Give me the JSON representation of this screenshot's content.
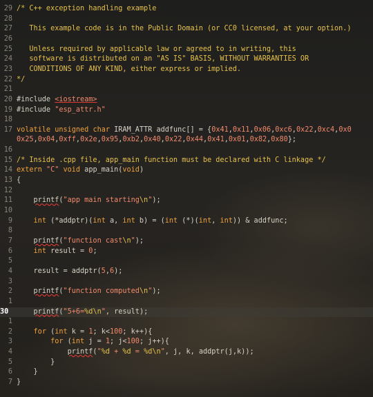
{
  "editor": {
    "lines": [
      {
        "ln": "29",
        "code": "/* C++ exception handling example"
      },
      {
        "ln": "28",
        "code": ""
      },
      {
        "ln": "27",
        "code": "   This example code is in the Public Domain (or CC0 licensed, at your option.)"
      },
      {
        "ln": "26",
        "code": ""
      },
      {
        "ln": "25",
        "code": "   Unless required by applicable law or agreed to in writing, this"
      },
      {
        "ln": "24",
        "code": "   software is distributed on an \"AS IS\" BASIS, WITHOUT WARRANTIES OR"
      },
      {
        "ln": "23",
        "code": "   CONDITIONS OF ANY KIND, either express or implied."
      },
      {
        "ln": "22",
        "code": "*/"
      },
      {
        "ln": "21",
        "code": ""
      },
      {
        "ln": "20",
        "code": "#include <iostream>"
      },
      {
        "ln": "19",
        "code": "#include \"esp_attr.h\""
      },
      {
        "ln": "18",
        "code": ""
      },
      {
        "ln": "17",
        "code": "volatile unsigned char IRAM_ATTR addfunc[] = {0x41,0x11,0x06,0xc6,0x22,0xc4,0x0"
      },
      {
        "ln": "",
        "code": "0x25,0x04,0xff,0x2e,0x95,0xb2,0x40,0x22,0x44,0x41,0x01,0x82,0x80};"
      },
      {
        "ln": "16",
        "code": ""
      },
      {
        "ln": "15",
        "code": "/* Inside .cpp file, app_main function must be declared with C linkage */"
      },
      {
        "ln": "14",
        "code": "extern \"C\" void app_main(void)"
      },
      {
        "ln": "13",
        "code": "{"
      },
      {
        "ln": "12",
        "code": ""
      },
      {
        "ln": "11",
        "code": "    printf(\"app main starting\\n\");"
      },
      {
        "ln": "10",
        "code": ""
      },
      {
        "ln": "9",
        "code": "    int (*addptr)(int a, int b) = (int (*)(int, int)) & addfunc;"
      },
      {
        "ln": "8",
        "code": ""
      },
      {
        "ln": "7",
        "code": "    printf(\"function cast\\n\");"
      },
      {
        "ln": "6",
        "code": "    int result = 0;"
      },
      {
        "ln": "5",
        "code": ""
      },
      {
        "ln": "4",
        "code": "    result = addptr(5,6);"
      },
      {
        "ln": "3",
        "code": ""
      },
      {
        "ln": "2",
        "code": "    printf(\"function computed\\n\");"
      },
      {
        "ln": "1",
        "code": ""
      },
      {
        "ln": "30",
        "code": "    printf(\"5+6=%d\\n\", result);",
        "current": true
      },
      {
        "ln": "1",
        "code": ""
      },
      {
        "ln": "2",
        "code": "    for (int k = 1; k<100; k++){"
      },
      {
        "ln": "3",
        "code": "        for (int j = 1; j<100; j++){"
      },
      {
        "ln": "4",
        "code": "            printf(\"%d + %d = %d\\n\", j, k, addptr(j,k));"
      },
      {
        "ln": "5",
        "code": "        }"
      },
      {
        "ln": "6",
        "code": "    }"
      },
      {
        "ln": "7",
        "code": "}"
      }
    ]
  },
  "colors": {
    "comment": "#e7c24a",
    "keyword": "#f0a23c",
    "string": "#f28a6c",
    "text": "#d8d3c6",
    "line_number": "#8b8579"
  }
}
